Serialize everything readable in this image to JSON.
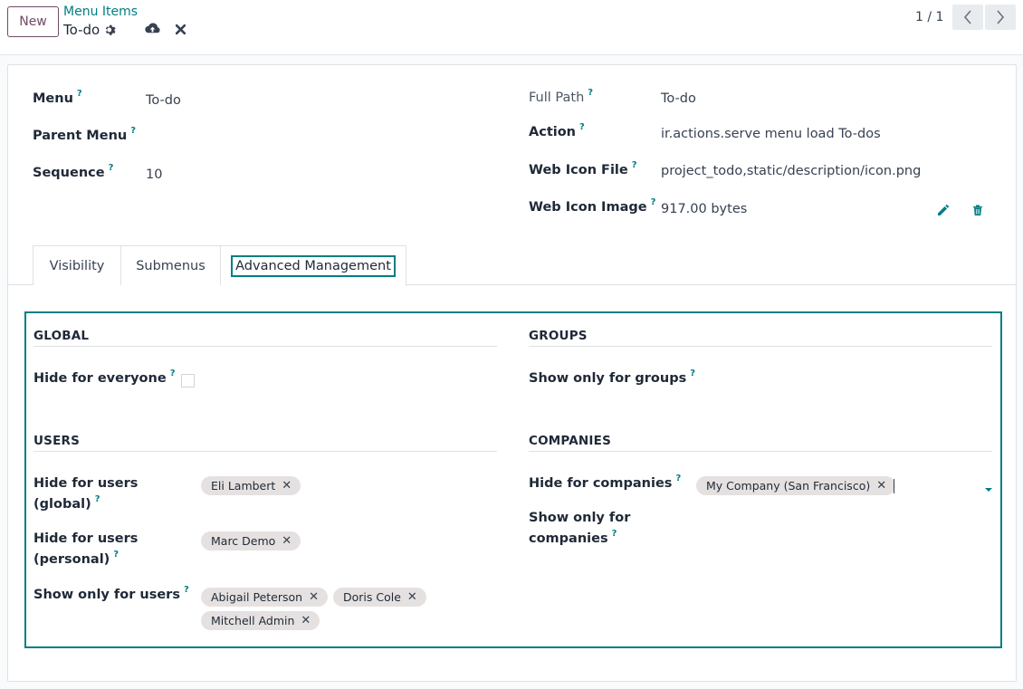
{
  "control_panel": {
    "new_label": "New",
    "breadcrumb_parent": "Menu Items",
    "breadcrumb_current": "To-do",
    "pager_value": "1 / 1"
  },
  "form": {
    "menu_label": "Menu",
    "menu_value": "To-do",
    "parent_menu_label": "Parent Menu",
    "sequence_label": "Sequence",
    "sequence_value": "10",
    "full_path_label": "Full Path",
    "full_path_value": "To-do",
    "action_label": "Action",
    "action_type_value": "ir.actions.serve",
    "action_value": "menu load To-dos",
    "web_icon_file_label": "Web Icon File",
    "web_icon_file_value": "project_todo,static/description/icon.png",
    "web_icon_image_label": "Web Icon Image",
    "web_icon_image_value": "917.00 bytes",
    "help_mark": "?"
  },
  "tabs": [
    {
      "label": "Visibility"
    },
    {
      "label": "Submenus"
    },
    {
      "label": "Advanced Management",
      "active": true
    }
  ],
  "advanced": {
    "global_title": "GLOBAL",
    "hide_everyone_label": "Hide for everyone",
    "hide_everyone_checked": false,
    "users_title": "USERS",
    "hide_users_global_label_1": "Hide for users",
    "hide_users_global_label_2": "(global)",
    "hide_users_global_tags": [
      "Eli Lambert"
    ],
    "hide_users_personal_label_1": "Hide for users",
    "hide_users_personal_label_2": "(personal)",
    "hide_users_personal_tags": [
      "Marc Demo"
    ],
    "show_users_label": "Show only for users",
    "show_users_tags": [
      "Abigail Peterson",
      "Doris Cole",
      "Mitchell Admin"
    ],
    "groups_title": "GROUPS",
    "show_groups_label": "Show only for groups",
    "companies_title": "COMPANIES",
    "hide_companies_label": "Hide for companies",
    "hide_companies_tags": [
      "My Company (San Francisco)"
    ],
    "show_companies_label_1": "Show only for",
    "show_companies_label_2": "companies"
  },
  "colors": {
    "brand": "#714b67",
    "accent": "#017e84",
    "tag_bg": "#e5e1e0"
  },
  "icons": [
    "gear-icon",
    "cloud-upload-icon",
    "close-icon",
    "chevron-left-icon",
    "chevron-right-icon",
    "pencil-icon",
    "trash-icon",
    "caret-down-icon"
  ]
}
